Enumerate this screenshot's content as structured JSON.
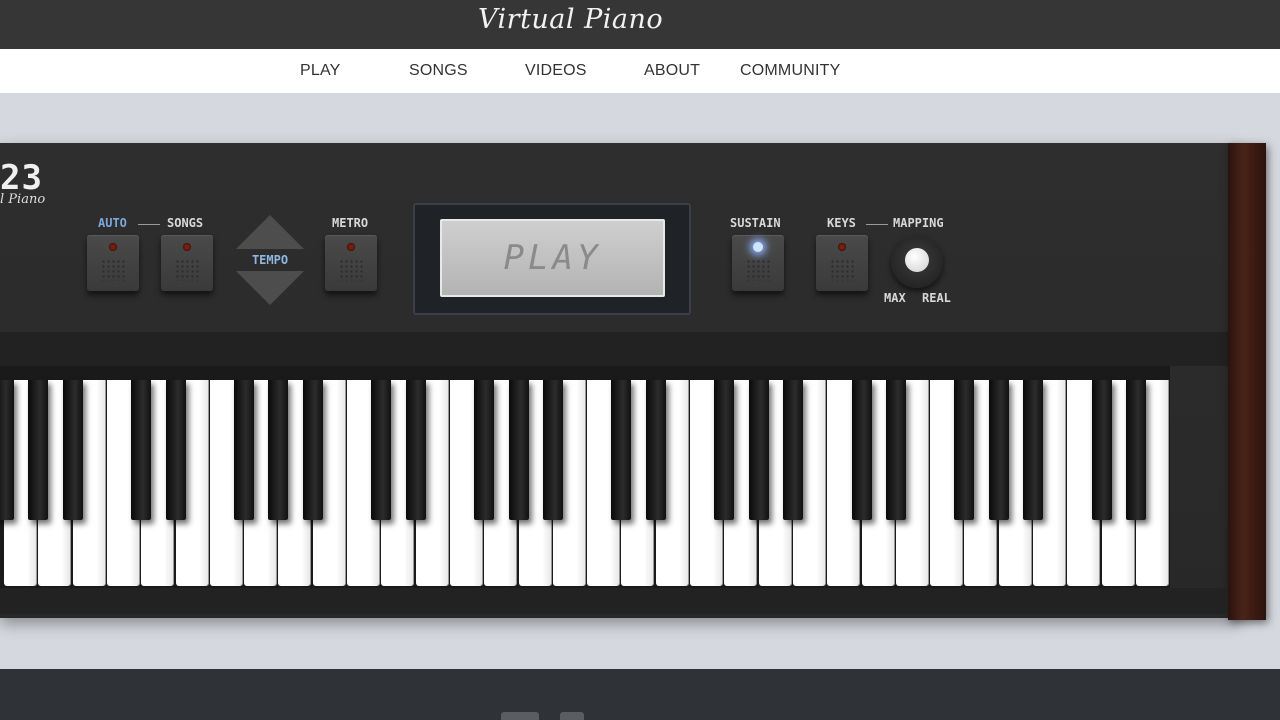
{
  "header": {
    "logo_text": "Virtual Piano"
  },
  "nav": {
    "items": [
      "PLAY",
      "SONGS",
      "VIDEOS",
      "ABOUT",
      "COMMUNITY"
    ]
  },
  "piano": {
    "brand_number": "23",
    "brand_sub": "l Piano",
    "labels": {
      "auto": "AUTO",
      "songs": "SONGS",
      "tempo": "TEMPO",
      "metro": "METRO",
      "sustain": "SUSTAIN",
      "keys": "KEYS",
      "mapping": "MAPPING",
      "max": "MAX",
      "real": "REAL"
    },
    "display_text": "PLAY",
    "sustain_on": true
  },
  "colors": {
    "header_bg": "#363636",
    "panel_bg": "#2e2e2e",
    "accent_blue": "#7ea7d8",
    "led_off": "#7a1f12",
    "led_on": "#cfe3ff",
    "wood": "#4a2318"
  }
}
